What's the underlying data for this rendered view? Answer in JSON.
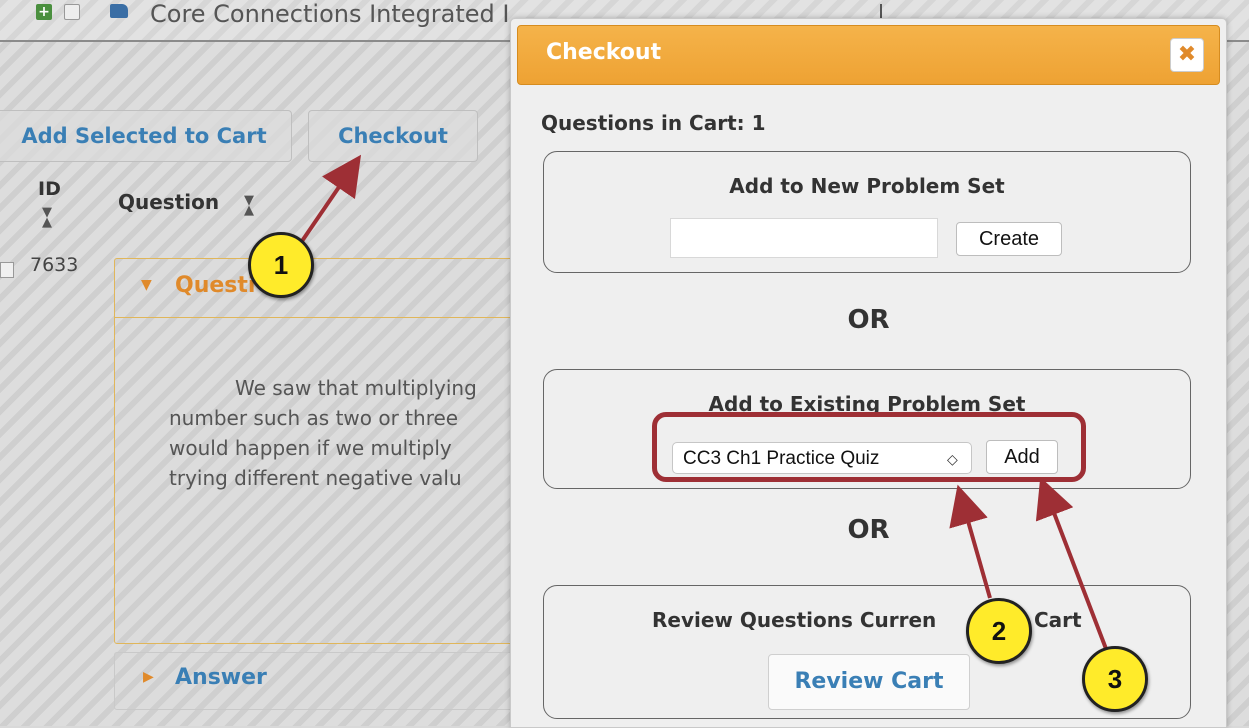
{
  "background": {
    "tab_title": "Core Connections Integrated I",
    "add_selected_label": "Add Selected to Cart",
    "checkout_label": "Checkout",
    "column_id": "ID",
    "column_question": "Question",
    "question_id": "7633",
    "question_section_label": "Questi",
    "question_text_lines": [
      "We saw that multiplying",
      "number such as two or three",
      "would happen if we multiply",
      "trying different negative valu"
    ],
    "answer_section_label": "Answer"
  },
  "modal": {
    "title": "Checkout",
    "close_glyph": "✖",
    "cart_count_label": "Questions in Cart: 1",
    "new_set": {
      "title": "Add to New Problem Set",
      "input_value": "",
      "create_label": "Create"
    },
    "or_label": "OR",
    "existing_set": {
      "title": "Add to Existing Problem Set",
      "selected_option": "CC3 Ch1 Practice Quiz",
      "add_label": "Add"
    },
    "review": {
      "title_left": "Review Questions Curren",
      "title_right": "Cart",
      "button_label": "Review Cart"
    }
  },
  "annotations": {
    "callout_1": "1",
    "callout_2": "2",
    "callout_3": "3",
    "arrow_color": "#9e2f35",
    "callout_color": "#ffeb2a"
  },
  "colors": {
    "accent_orange": "#eea233",
    "link_blue": "#3a7fb5",
    "highlight_red": "#9e2f35"
  }
}
